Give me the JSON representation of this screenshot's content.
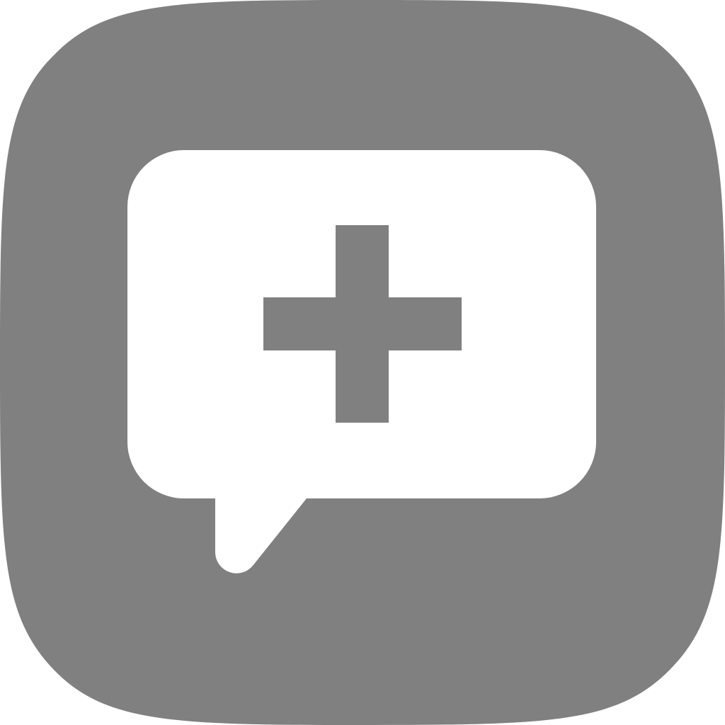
{
  "app_icon": {
    "name": "new-message",
    "background_color": "#808080",
    "bubble_color": "#ffffff",
    "glyph_color": "#808080",
    "icons": [
      "speech-bubble-icon",
      "plus-icon"
    ]
  }
}
